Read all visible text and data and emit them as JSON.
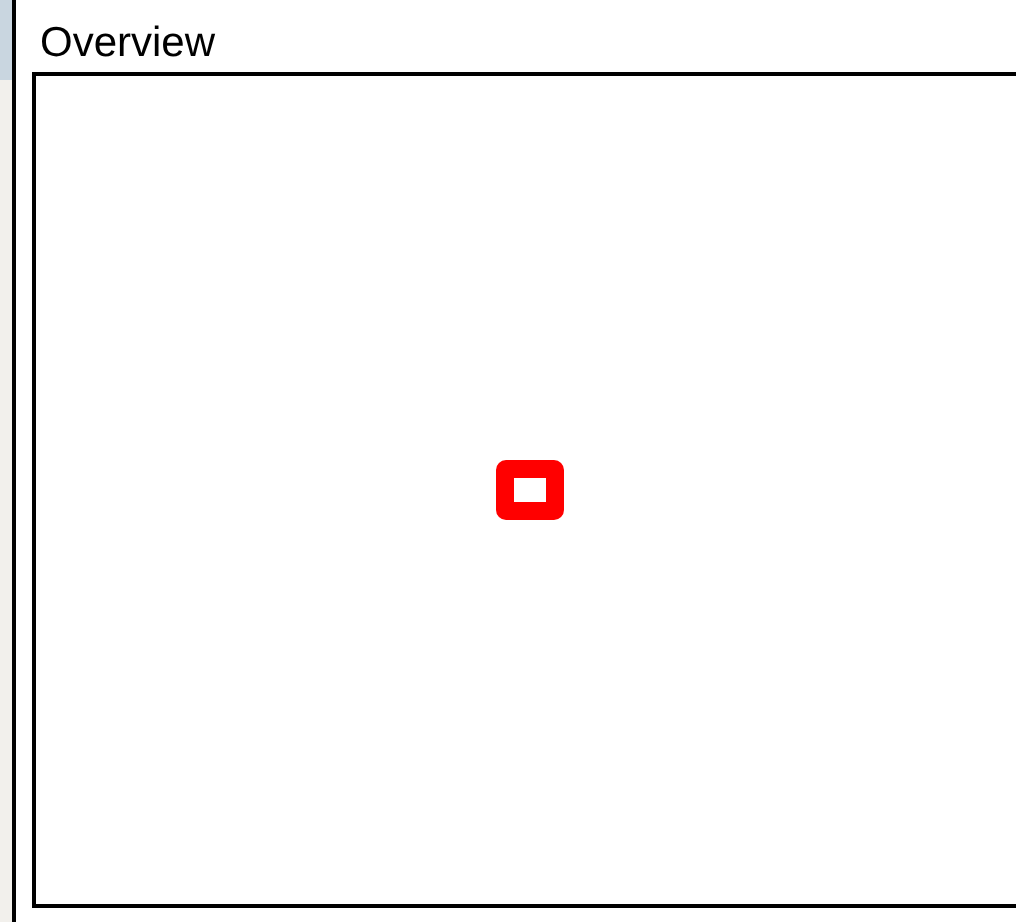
{
  "panel": {
    "title": "Overview"
  }
}
